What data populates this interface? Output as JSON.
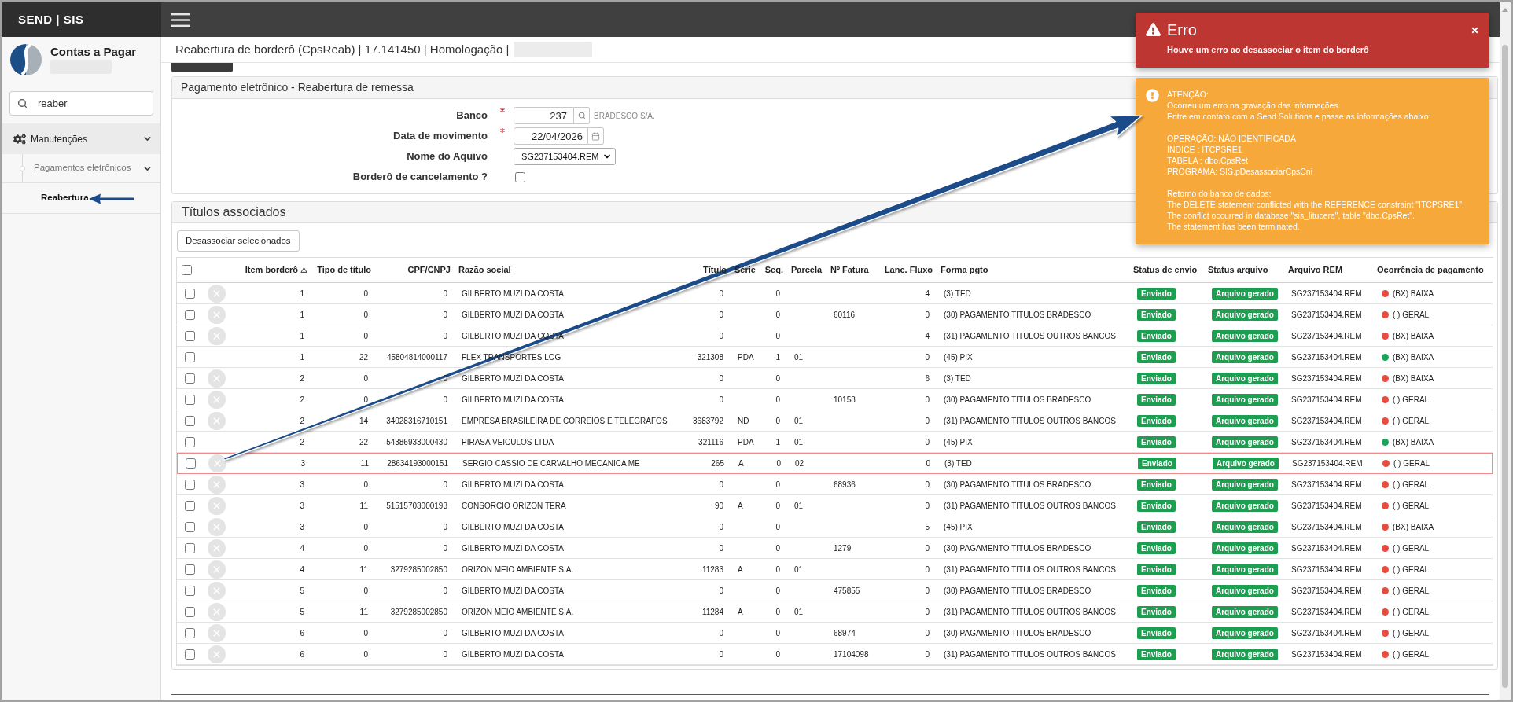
{
  "header": {
    "brand": "SEND | SIS"
  },
  "sidebar": {
    "module": "Contas a Pagar",
    "search": {
      "value": "reaber"
    },
    "menu": [
      {
        "label": "Manutenções",
        "selected": false,
        "expanded": true,
        "children": [
          {
            "label": "Pagamentos eletrônicos",
            "selected": false,
            "expanded": true,
            "children": [
              {
                "label": "Reabertura",
                "selected": true
              }
            ]
          }
        ]
      }
    ]
  },
  "page": {
    "title": "Reabertura de borderô (CpsReab) | 17.141450 | Homologação |"
  },
  "form": {
    "title": "Pagamento eletrônico - Reabertura de remessa",
    "fields": [
      {
        "kind": "lookup",
        "label": "Banco",
        "required": true,
        "value": "237",
        "note": "BRADESCO S/A."
      },
      {
        "kind": "date",
        "label": "Data de movimento",
        "required": true,
        "value": "22/04/2026"
      },
      {
        "kind": "select",
        "label": "Nome do Aquivo",
        "required": false,
        "value": "SG237153404.REM"
      },
      {
        "kind": "checkbox",
        "label": "Borderô de cancelamento ?",
        "required": false,
        "checked": false
      }
    ]
  },
  "titles": {
    "title": "Títulos associados",
    "action": "Desassociar selecionados",
    "header_checked": false,
    "columns": [
      {
        "label": "Item borderô",
        "sorted": true
      },
      {
        "label": "Tipo de título",
        "sorted": false
      },
      {
        "label": "CPF/CNPJ",
        "sorted": false
      },
      {
        "label": "Razão social",
        "sorted": false
      },
      {
        "label": "Título",
        "sorted": false
      },
      {
        "label": "Série",
        "sorted": false
      },
      {
        "label": "Seq.",
        "sorted": false
      },
      {
        "label": "Parcela",
        "sorted": false
      },
      {
        "label": "Nº Fatura",
        "sorted": false
      },
      {
        "label": "Lanc. Fluxo",
        "sorted": false
      },
      {
        "label": "Forma pgto",
        "sorted": false
      },
      {
        "label": "Status de envio",
        "sorted": false
      },
      {
        "label": "Status arquivo",
        "sorted": false
      },
      {
        "label": "Arquivo REM",
        "sorted": false
      },
      {
        "label": "Ocorrência de pagamento",
        "sorted": false
      }
    ],
    "rows": [
      {
        "checked": false,
        "removable": true,
        "highlighted": false,
        "item": "1",
        "type": "0",
        "cpf_cnpj": "0",
        "company": "GILBERTO MUZI DA COSTA",
        "title_no": "0",
        "seq": "0",
        "cash_flow": "4",
        "payment_form": "(3) TED",
        "send_status": "Enviado",
        "file_status": "Arquivo gerado",
        "rem_file": "SG237153404.REM",
        "occurrence": {
          "label": "(BX) BAIXA",
          "color": "#e74c3c"
        }
      },
      {
        "checked": false,
        "removable": true,
        "highlighted": false,
        "item": "1",
        "type": "0",
        "cpf_cnpj": "0",
        "company": "GILBERTO MUZI DA COSTA",
        "title_no": "0",
        "seq": "0",
        "invoice": "60116",
        "cash_flow": "0",
        "payment_form": "(30) PAGAMENTO TITULOS BRADESCO",
        "send_status": "Enviado",
        "file_status": "Arquivo gerado",
        "rem_file": "SG237153404.REM",
        "occurrence": {
          "label": "( ) GERAL",
          "color": "#e74c3c"
        }
      },
      {
        "checked": false,
        "removable": true,
        "highlighted": false,
        "item": "1",
        "type": "0",
        "cpf_cnpj": "0",
        "company": "GILBERTO MUZI DA COSTA",
        "title_no": "0",
        "seq": "0",
        "cash_flow": "4",
        "payment_form": "(31) PAGAMENTO TITULOS OUTROS BANCOS",
        "send_status": "Enviado",
        "file_status": "Arquivo gerado",
        "rem_file": "SG237153404.REM",
        "occurrence": {
          "label": "(BX) BAIXA",
          "color": "#e74c3c"
        }
      },
      {
        "checked": false,
        "removable": false,
        "highlighted": false,
        "item": "1",
        "type": "22",
        "cpf_cnpj": "45804814000117",
        "company": "FLEX TRANSPORTES LOG",
        "title_no": "321308",
        "series": "PDA",
        "seq": "1",
        "installment": "01",
        "cash_flow": "0",
        "payment_form": "(45) PIX",
        "send_status": "Enviado",
        "file_status": "Arquivo gerado",
        "rem_file": "SG237153404.REM",
        "occurrence": {
          "label": "(BX) BAIXA",
          "color": "#19a55a"
        }
      },
      {
        "checked": false,
        "removable": true,
        "highlighted": false,
        "item": "2",
        "type": "0",
        "cpf_cnpj": "0",
        "company": "GILBERTO MUZI DA COSTA",
        "title_no": "0",
        "seq": "0",
        "cash_flow": "6",
        "payment_form": "(3) TED",
        "send_status": "Enviado",
        "file_status": "Arquivo gerado",
        "rem_file": "SG237153404.REM",
        "occurrence": {
          "label": "(BX) BAIXA",
          "color": "#e74c3c"
        }
      },
      {
        "checked": false,
        "removable": true,
        "highlighted": false,
        "item": "2",
        "type": "0",
        "cpf_cnpj": "0",
        "company": "GILBERTO MUZI DA COSTA",
        "title_no": "0",
        "seq": "0",
        "invoice": "10158",
        "cash_flow": "0",
        "payment_form": "(30) PAGAMENTO TITULOS BRADESCO",
        "send_status": "Enviado",
        "file_status": "Arquivo gerado",
        "rem_file": "SG237153404.REM",
        "occurrence": {
          "label": "( ) GERAL",
          "color": "#e74c3c"
        }
      },
      {
        "checked": false,
        "removable": true,
        "highlighted": false,
        "item": "2",
        "type": "14",
        "cpf_cnpj": "34028316710151",
        "company": "EMPRESA BRASILEIRA DE CORREIOS E TELEGRAFOS",
        "title_no": "3683792",
        "series": "ND",
        "seq": "0",
        "installment": "01",
        "cash_flow": "0",
        "payment_form": "(31) PAGAMENTO TITULOS OUTROS BANCOS",
        "send_status": "Enviado",
        "file_status": "Arquivo gerado",
        "rem_file": "SG237153404.REM",
        "occurrence": {
          "label": "( ) GERAL",
          "color": "#e74c3c"
        }
      },
      {
        "checked": false,
        "removable": false,
        "highlighted": false,
        "item": "2",
        "type": "22",
        "cpf_cnpj": "54386933000430",
        "company": "PIRASA VEICULOS LTDA",
        "title_no": "321116",
        "series": "PDA",
        "seq": "1",
        "installment": "01",
        "cash_flow": "0",
        "payment_form": "(45) PIX",
        "send_status": "Enviado",
        "file_status": "Arquivo gerado",
        "rem_file": "SG237153404.REM",
        "occurrence": {
          "label": "(BX) BAIXA",
          "color": "#19a55a"
        }
      },
      {
        "checked": false,
        "removable": true,
        "highlighted": true,
        "item": "3",
        "type": "11",
        "cpf_cnpj": "28634193000151",
        "company": "SERGIO CASSIO DE CARVALHO MECANICA ME",
        "title_no": "265",
        "series": "A",
        "seq": "0",
        "installment": "02",
        "cash_flow": "0",
        "payment_form": "(3) TED",
        "send_status": "Enviado",
        "file_status": "Arquivo gerado",
        "rem_file": "SG237153404.REM",
        "occurrence": {
          "label": "( ) GERAL",
          "color": "#e74c3c"
        }
      },
      {
        "checked": false,
        "removable": true,
        "highlighted": false,
        "item": "3",
        "type": "0",
        "cpf_cnpj": "0",
        "company": "GILBERTO MUZI DA COSTA",
        "title_no": "0",
        "seq": "0",
        "invoice": "68936",
        "cash_flow": "0",
        "payment_form": "(30) PAGAMENTO TITULOS BRADESCO",
        "send_status": "Enviado",
        "file_status": "Arquivo gerado",
        "rem_file": "SG237153404.REM",
        "occurrence": {
          "label": "( ) GERAL",
          "color": "#e74c3c"
        }
      },
      {
        "checked": false,
        "removable": true,
        "highlighted": false,
        "item": "3",
        "type": "11",
        "cpf_cnpj": "51515703000193",
        "company": "CONSORCIO ORIZON TERA",
        "title_no": "90",
        "series": "A",
        "seq": "0",
        "installment": "01",
        "cash_flow": "0",
        "payment_form": "(31) PAGAMENTO TITULOS OUTROS BANCOS",
        "send_status": "Enviado",
        "file_status": "Arquivo gerado",
        "rem_file": "SG237153404.REM",
        "occurrence": {
          "label": "( ) GERAL",
          "color": "#e74c3c"
        }
      },
      {
        "checked": false,
        "removable": true,
        "highlighted": false,
        "item": "3",
        "type": "0",
        "cpf_cnpj": "0",
        "company": "GILBERTO MUZI DA COSTA",
        "title_no": "0",
        "seq": "0",
        "cash_flow": "5",
        "payment_form": "(45) PIX",
        "send_status": "Enviado",
        "file_status": "Arquivo gerado",
        "rem_file": "SG237153404.REM",
        "occurrence": {
          "label": "(BX) BAIXA",
          "color": "#e74c3c"
        }
      },
      {
        "checked": false,
        "removable": true,
        "highlighted": false,
        "item": "4",
        "type": "0",
        "cpf_cnpj": "0",
        "company": "GILBERTO MUZI DA COSTA",
        "title_no": "0",
        "seq": "0",
        "invoice": "1279",
        "cash_flow": "0",
        "payment_form": "(30) PAGAMENTO TITULOS BRADESCO",
        "send_status": "Enviado",
        "file_status": "Arquivo gerado",
        "rem_file": "SG237153404.REM",
        "occurrence": {
          "label": "( ) GERAL",
          "color": "#e74c3c"
        }
      },
      {
        "checked": false,
        "removable": true,
        "highlighted": false,
        "item": "4",
        "type": "11",
        "cpf_cnpj": "3279285002850",
        "company": "ORIZON MEIO AMBIENTE S.A.",
        "title_no": "11283",
        "series": "A",
        "seq": "0",
        "installment": "01",
        "cash_flow": "0",
        "payment_form": "(31) PAGAMENTO TITULOS OUTROS BANCOS",
        "send_status": "Enviado",
        "file_status": "Arquivo gerado",
        "rem_file": "SG237153404.REM",
        "occurrence": {
          "label": "( ) GERAL",
          "color": "#e74c3c"
        }
      },
      {
        "checked": false,
        "removable": true,
        "highlighted": false,
        "item": "5",
        "type": "0",
        "cpf_cnpj": "0",
        "company": "GILBERTO MUZI DA COSTA",
        "title_no": "0",
        "seq": "0",
        "invoice": "475855",
        "cash_flow": "0",
        "payment_form": "(30) PAGAMENTO TITULOS BRADESCO",
        "send_status": "Enviado",
        "file_status": "Arquivo gerado",
        "rem_file": "SG237153404.REM",
        "occurrence": {
          "label": "( ) GERAL",
          "color": "#e74c3c"
        }
      },
      {
        "checked": false,
        "removable": true,
        "highlighted": false,
        "item": "5",
        "type": "11",
        "cpf_cnpj": "3279285002850",
        "company": "ORIZON MEIO AMBIENTE S.A.",
        "title_no": "11284",
        "series": "A",
        "seq": "0",
        "installment": "01",
        "cash_flow": "0",
        "payment_form": "(31) PAGAMENTO TITULOS OUTROS BANCOS",
        "send_status": "Enviado",
        "file_status": "Arquivo gerado",
        "rem_file": "SG237153404.REM",
        "occurrence": {
          "label": "( ) GERAL",
          "color": "#e74c3c"
        }
      },
      {
        "checked": false,
        "removable": true,
        "highlighted": false,
        "item": "6",
        "type": "0",
        "cpf_cnpj": "0",
        "company": "GILBERTO MUZI DA COSTA",
        "title_no": "0",
        "seq": "0",
        "invoice": "68974",
        "cash_flow": "0",
        "payment_form": "(30) PAGAMENTO TITULOS BRADESCO",
        "send_status": "Enviado",
        "file_status": "Arquivo gerado",
        "rem_file": "SG237153404.REM",
        "occurrence": {
          "label": "( ) GERAL",
          "color": "#e74c3c"
        }
      },
      {
        "checked": false,
        "removable": true,
        "highlighted": false,
        "item": "6",
        "type": "0",
        "cpf_cnpj": "0",
        "company": "GILBERTO MUZI DA COSTA",
        "title_no": "0",
        "seq": "0",
        "invoice": "17104098",
        "cash_flow": "0",
        "payment_form": "(31) PAGAMENTO TITULOS OUTROS BANCOS",
        "send_status": "Enviado",
        "file_status": "Arquivo gerado",
        "rem_file": "SG237153404.REM",
        "occurrence": {
          "label": "( ) GERAL",
          "color": "#e74c3c"
        }
      }
    ]
  },
  "notifications": [
    {
      "kind": "error",
      "title": "Erro",
      "message": "Houve um erro ao desassociar o item do borderô"
    },
    {
      "kind": "warning",
      "paragraphs": [
        [
          "ATENÇÃO:",
          "Ocorreu um erro na gravação das informações.",
          "Entre em contato com a Send Solutions e passe as informações abaixo:"
        ],
        [
          "OPERAÇÃO: NÃO IDENTIFICADA",
          "ÍNDICE : ITCPSRE1",
          "TABELA : dbo.CpsRet",
          "PROGRAMA: SIS.pDesassociarCpsCni"
        ],
        [
          "Retorno do banco de dados:",
          "The DELETE statement conflicted with the REFERENCE constraint \"ITCPSRE1\".",
          "The conflict occurred in database \"sis_litucera\", table \"dbo.CpsRet\".",
          "The statement has been terminated."
        ]
      ]
    }
  ]
}
